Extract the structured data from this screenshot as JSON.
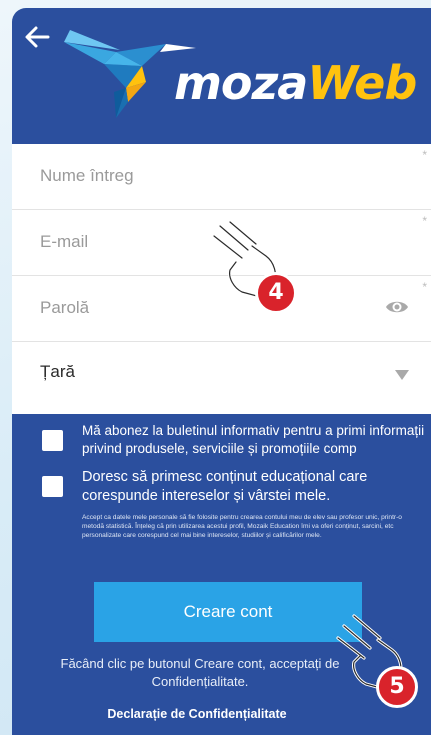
{
  "header": {
    "brand_part1": "moza",
    "brand_part2": "Web"
  },
  "form": {
    "full_name_placeholder": "Nume întreg",
    "email_placeholder": "E-mail",
    "password_placeholder": "Parolă",
    "country_label": "Țară",
    "required_mark": "*"
  },
  "consent": {
    "newsletter_text": "Mă abonez la buletinul informativ pentru a primi informații privind produsele, serviciile și promoțiile comp",
    "educational_text": "Doresc să primesc conținut educațional care corespunde intereselor și vârstei mele.",
    "legal_text": "Accept ca datele mele personale să fie folosite pentru crearea contului meu de elev sau profesor unic, printr-o metodă statistică. Înțeleg că prin utilizarea acestui profil, Mozaik Education îmi va oferi conținut, sarcini, etc personalizate care corespund cel mai bine intereselor, studiilor și calificărilor mele."
  },
  "actions": {
    "create_account_label": "Creare cont",
    "agree_text": "Făcând clic pe butonul Creare cont, acceptați de Confidențialitate.",
    "privacy_link": "Declarație de Confidențialitate"
  },
  "annotations": {
    "step_4": "4",
    "step_5": "5"
  },
  "colors": {
    "primary_blue": "#2b4f9e",
    "button_blue": "#2aa3e6",
    "accent_yellow": "#ffc20e",
    "badge_red": "#d9232b"
  },
  "icons": [
    "back-arrow-icon",
    "hummingbird-logo-icon",
    "eye-icon",
    "dropdown-caret-icon",
    "pointing-hand-icon"
  ]
}
